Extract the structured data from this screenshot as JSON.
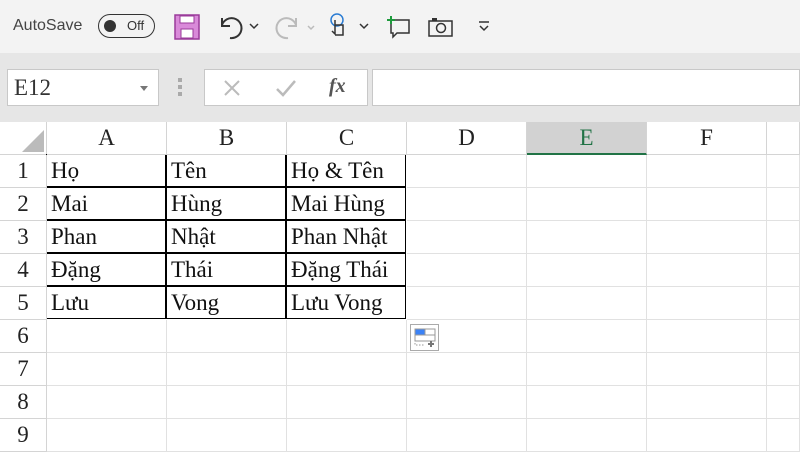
{
  "toolbar": {
    "autosave_label": "AutoSave",
    "autosave_state": "Off"
  },
  "formula_bar": {
    "name_box": "E12",
    "formula": ""
  },
  "sheet": {
    "columns": [
      "A",
      "B",
      "C",
      "D",
      "E",
      "F"
    ],
    "selected_column": "E",
    "rows": [
      "1",
      "2",
      "3",
      "4",
      "5",
      "6",
      "7",
      "8",
      "9"
    ],
    "cells": [
      [
        "Họ",
        "Tên",
        "Họ & Tên"
      ],
      [
        "Mai",
        "Hùng",
        "Mai Hùng"
      ],
      [
        "Phan",
        "Nhật",
        "Phan Nhật"
      ],
      [
        "Đặng",
        "Thái",
        "Đặng Thái"
      ],
      [
        "Lưu",
        "Vong",
        "Lưu Vong"
      ]
    ]
  },
  "colors": {
    "accent": "#217346",
    "save_icon": "#c35bc3"
  }
}
